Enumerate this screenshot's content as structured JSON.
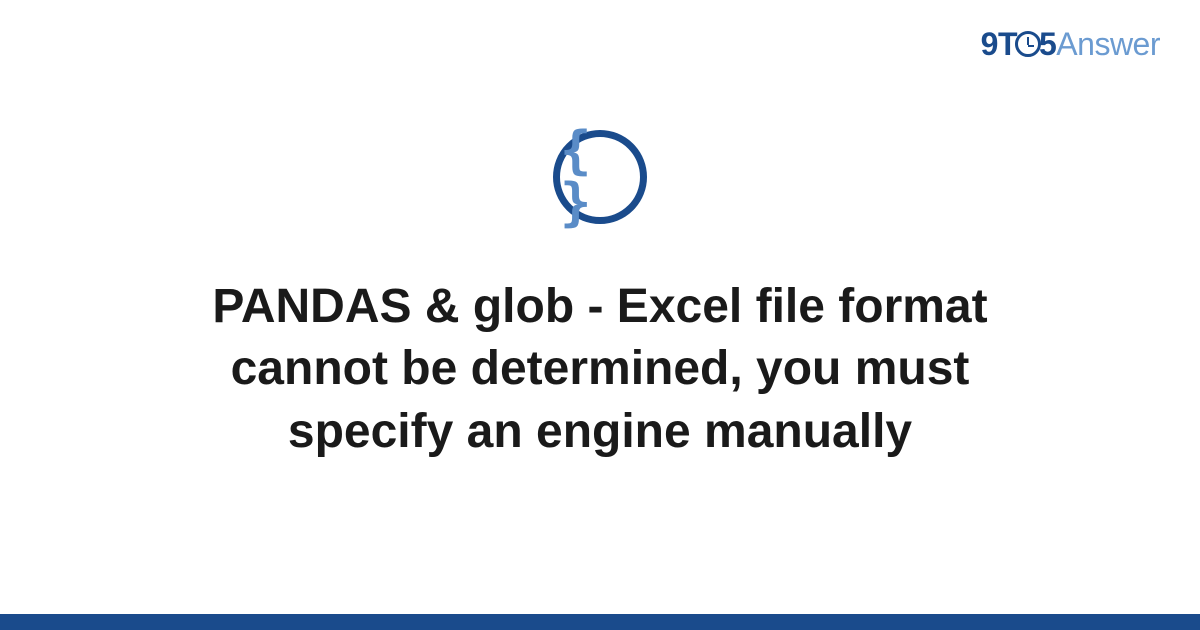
{
  "logo": {
    "part1": "9T",
    "part2": "5",
    "part3": "Answer"
  },
  "icon": {
    "name": "code-braces-icon",
    "braces": "{ }"
  },
  "title": "PANDAS & glob - Excel file format cannot be determined, you must specify an engine manually",
  "colors": {
    "primary": "#1a4b8c",
    "secondary": "#6b9bd1",
    "text": "#1a1a1a"
  }
}
